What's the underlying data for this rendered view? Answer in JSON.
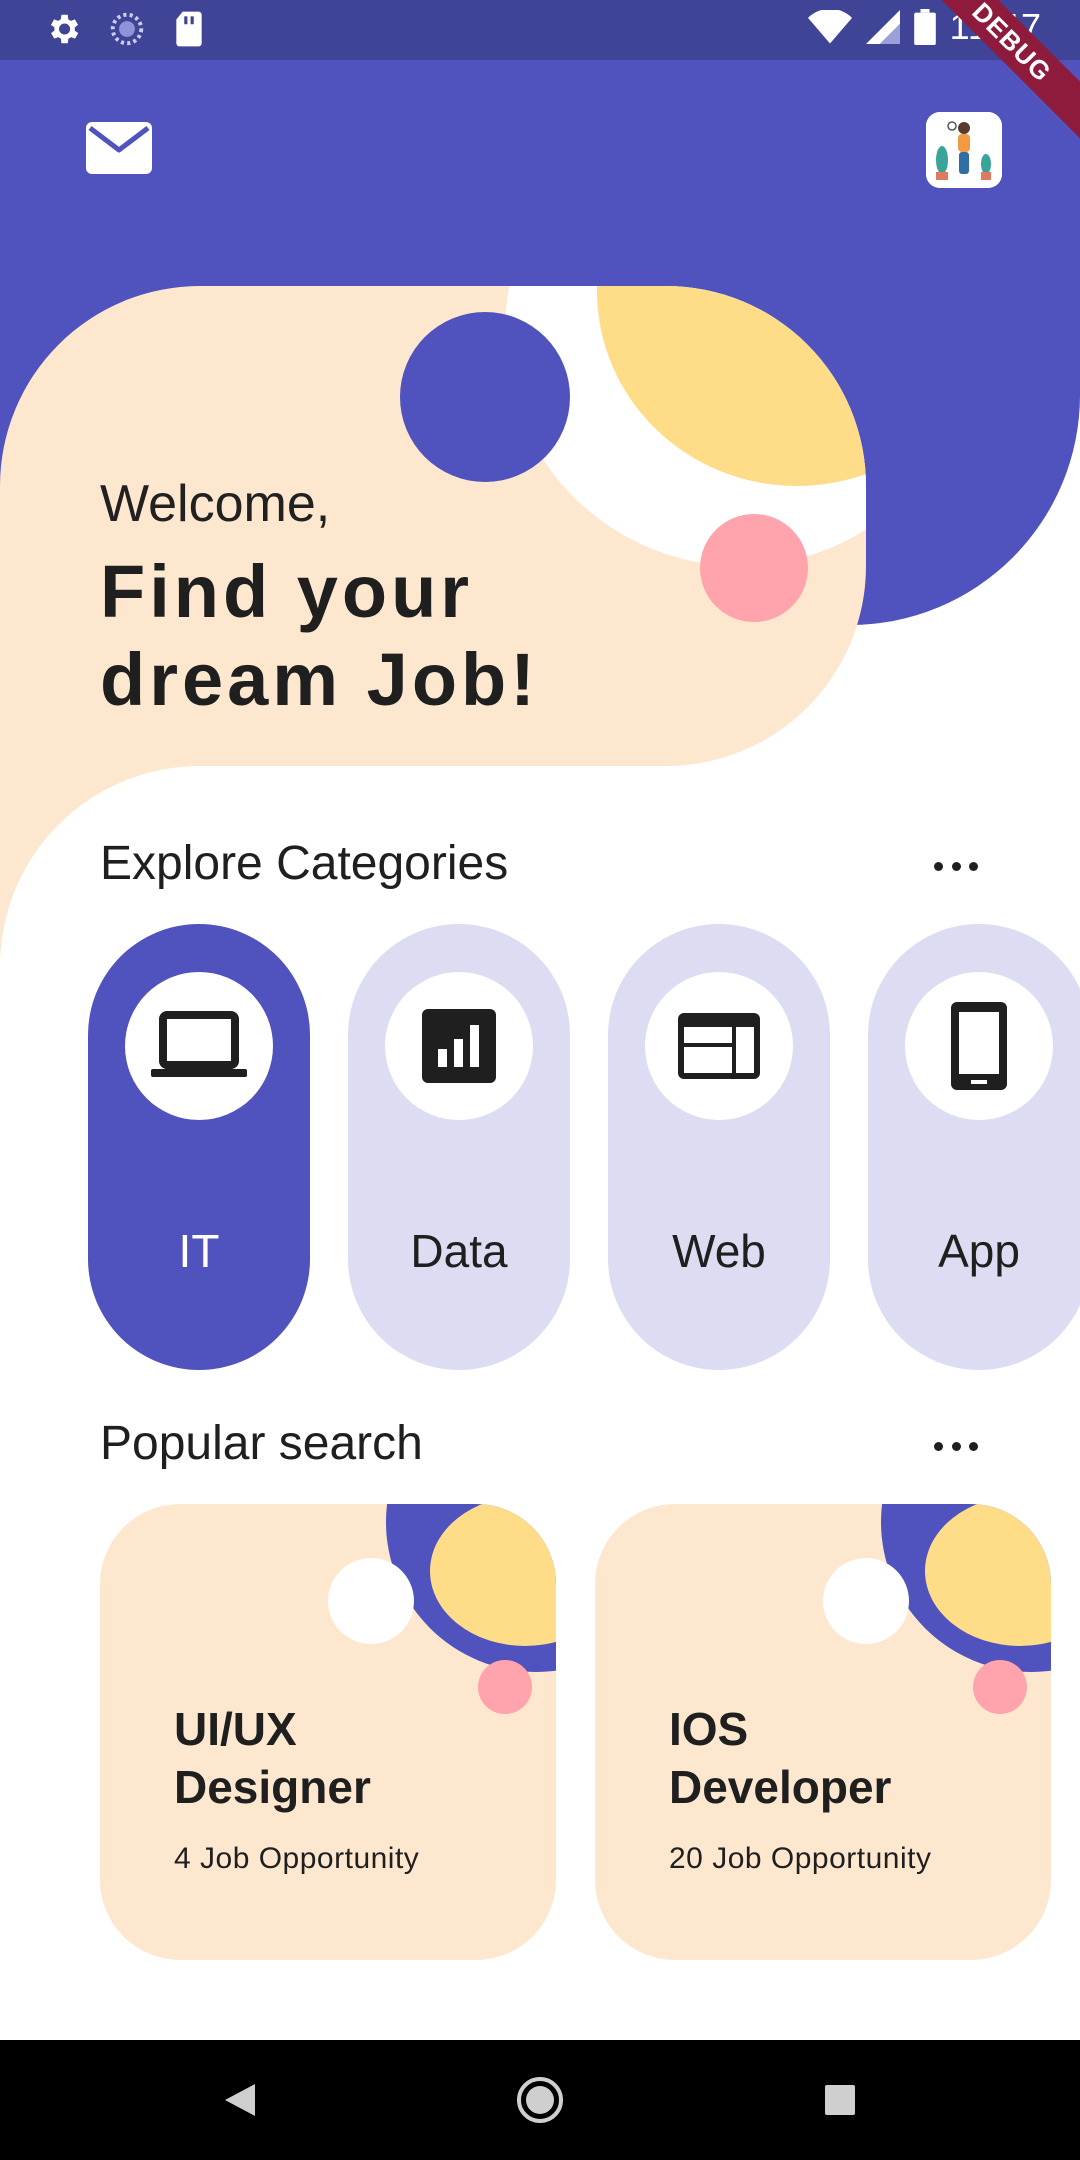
{
  "status_bar": {
    "time": "11:47",
    "left_icons": [
      "settings-icon",
      "sync-icon",
      "sd-card-icon"
    ],
    "right_icons": [
      "wifi-icon",
      "cell-signal-icon",
      "battery-icon"
    ],
    "debug_label": "DEBUG"
  },
  "header": {
    "mail_icon": "mail-icon",
    "avatar_icon": "profile-avatar"
  },
  "welcome": {
    "greeting": "Welcome,",
    "headline_line1": "Find your",
    "headline_line2": "dream Job!"
  },
  "categories": {
    "title": "Explore Categories",
    "items": [
      {
        "label": "IT",
        "icon": "laptop-icon",
        "active": true
      },
      {
        "label": "Data",
        "icon": "bar-chart-icon",
        "active": false
      },
      {
        "label": "Web",
        "icon": "web-layout-icon",
        "active": false
      },
      {
        "label": "App",
        "icon": "smartphone-icon",
        "active": false
      }
    ]
  },
  "popular": {
    "title": "Popular search",
    "cards": [
      {
        "title_line1": "UI/UX",
        "title_line2": "Designer",
        "subtitle": "4 Job Opportunity"
      },
      {
        "title_line1": "IOS",
        "title_line2": "Developer",
        "subtitle": "20 Job Opportunity"
      }
    ]
  },
  "colors": {
    "primary": "#5052be",
    "peach": "#fde8cf",
    "yellow": "#ffdc88",
    "pink": "#ffa3ad",
    "category_inactive": "#dcdcf2",
    "status_bar": "#3f4496"
  },
  "nav_bar": {
    "icons": [
      "back-icon",
      "home-icon",
      "recents-icon"
    ]
  }
}
